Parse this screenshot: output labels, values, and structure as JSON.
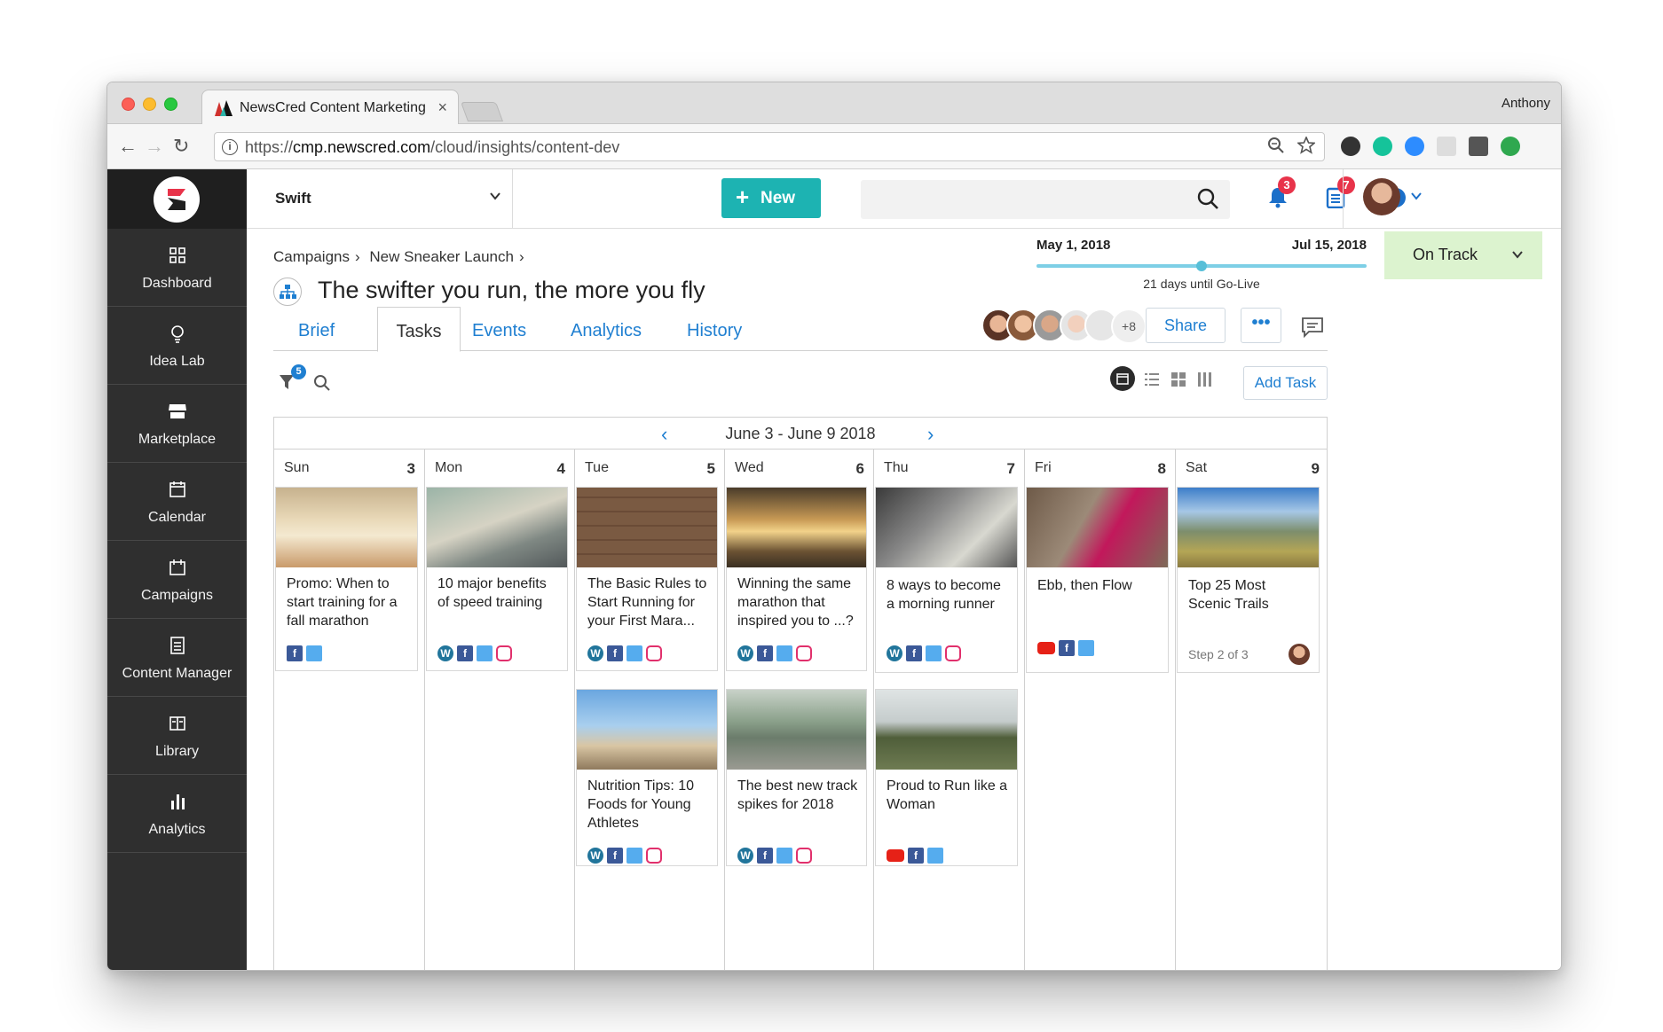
{
  "browser": {
    "tab_title": "NewsCred Content Marketing",
    "tab_close": "×",
    "user": "Anthony",
    "url_scheme": "https://",
    "url_host": "cmp.newscred.com",
    "url_path": "/cloud/insights/content-dev"
  },
  "sidebar": {
    "items": [
      {
        "label": "Dashboard",
        "icon": "dashboard-icon"
      },
      {
        "label": "Idea Lab",
        "icon": "lightbulb-icon"
      },
      {
        "label": "Marketplace",
        "icon": "store-icon"
      },
      {
        "label": "Calendar",
        "icon": "calendar-icon"
      },
      {
        "label": "Campaigns",
        "icon": "campaigns-icon"
      },
      {
        "label": "Content Manager",
        "icon": "document-icon"
      },
      {
        "label": "Library",
        "icon": "library-icon"
      },
      {
        "label": "Analytics",
        "icon": "bar-chart-icon"
      }
    ]
  },
  "topbar": {
    "workspace": "Swift",
    "new_label": "New",
    "new_plus": "+",
    "notifications_count": "3",
    "tasks_count": "7"
  },
  "breadcrumb": {
    "items": [
      "Campaigns",
      "New Sneaker Launch"
    ]
  },
  "page": {
    "title": "The swifter you run, the more you fly"
  },
  "timeline": {
    "start": "May 1, 2018",
    "end": "Jul 15, 2018",
    "subtitle": "21 days until Go-Live",
    "progress": 0.5
  },
  "status": {
    "label": "On Track",
    "color": "#dcf3cf"
  },
  "tabs": [
    "Brief",
    "Tasks",
    "Events",
    "Analytics",
    "History"
  ],
  "active_tab": "Tasks",
  "collaborators": {
    "more": "+8"
  },
  "actions": {
    "share": "Share",
    "more": "•••",
    "add_task": "Add Task"
  },
  "filter": {
    "count": "5"
  },
  "calendar": {
    "range": "June 3 - June 9 2018",
    "prev": "‹",
    "next": "›",
    "days": [
      {
        "name": "Sun",
        "num": "3"
      },
      {
        "name": "Mon",
        "num": "4"
      },
      {
        "name": "Tue",
        "num": "5"
      },
      {
        "name": "Wed",
        "num": "6"
      },
      {
        "name": "Thu",
        "num": "7"
      },
      {
        "name": "Fri",
        "num": "8"
      },
      {
        "name": "Sat",
        "num": "9"
      }
    ],
    "cards": {
      "sun1": "Promo: When to start training for a fall marathon",
      "mon1": "10 major benefits of speed training",
      "tue1": "The Basic Rules to Start Running for your First Mara...",
      "tue2": "Nutrition Tips: 10 Foods for Young Athletes",
      "wed1": "Winning the same marathon that inspired you to ...?",
      "wed2": "The best new track spikes for 2018",
      "thu1": "8 ways to become a morning runner",
      "thu2": "Proud to Run like a Woman",
      "fri1": "Ebb, then Flow",
      "sat1": "Top 25 Most Scenic Trails",
      "sat1_step": "Step 2 of 3"
    }
  },
  "colors": {
    "accent": "#1f7fd1",
    "new_button": "#1db3b2",
    "sidebar": "#2f2f2f",
    "badge": "#e8334a"
  }
}
